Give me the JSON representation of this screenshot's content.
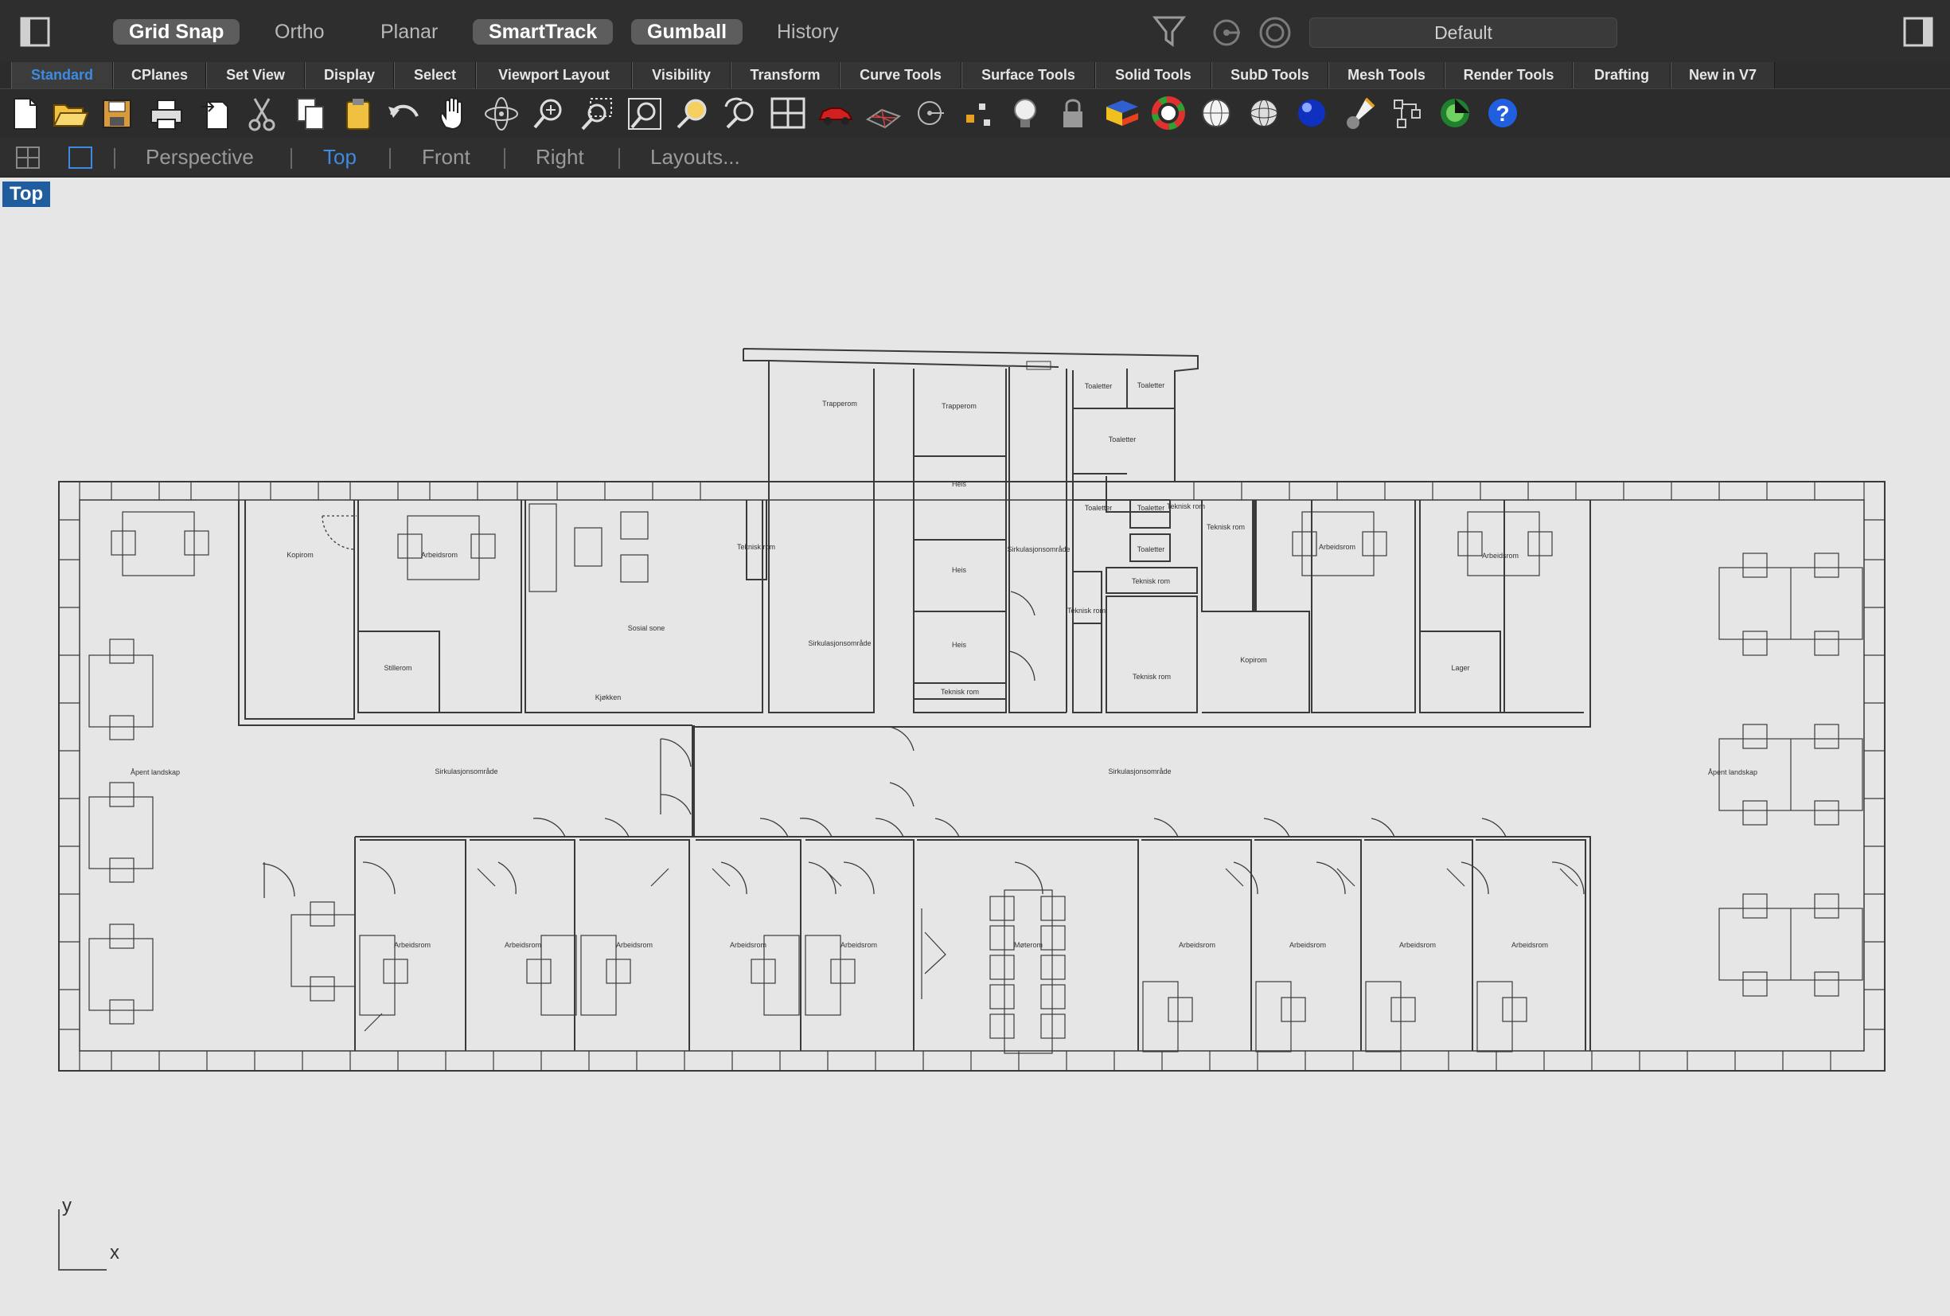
{
  "status_bar": {
    "toggles": [
      {
        "label": "Grid Snap",
        "on": true
      },
      {
        "label": "Ortho",
        "on": false
      },
      {
        "label": "Planar",
        "on": false
      },
      {
        "label": "SmartTrack",
        "on": true
      },
      {
        "label": "Gumball",
        "on": true
      },
      {
        "label": "History",
        "on": false
      }
    ],
    "layer": "Default"
  },
  "tabs": [
    "Standard",
    "CPlanes",
    "Set View",
    "Display",
    "Select",
    "Viewport Layout",
    "Visibility",
    "Transform",
    "Curve Tools",
    "Surface Tools",
    "Solid Tools",
    "SubD Tools",
    "Mesh Tools",
    "Render Tools",
    "Drafting",
    "New in V7"
  ],
  "active_tab": "Standard",
  "toolbar_icons": [
    "new-file-icon",
    "open-folder-icon",
    "save-icon",
    "print-icon",
    "import-icon",
    "cut-icon",
    "copy-icon",
    "paste-icon",
    "undo-icon",
    "pan-hand-icon",
    "rotate-view-icon",
    "zoom-icon",
    "zoom-window-icon",
    "zoom-extents-icon",
    "zoom-selected-icon",
    "undo-view-icon",
    "four-viewports-icon",
    "car-icon",
    "cplane-grid-icon",
    "circle-center-icon",
    "points-icon",
    "light-bulb-icon",
    "lock-icon",
    "layer-icon",
    "color-wheel-icon",
    "sphere-wire-icon",
    "sphere-shaded-icon",
    "sphere-render-icon",
    "spotlight-icon",
    "block-icon",
    "render-icon",
    "help-icon"
  ],
  "viewport_tabs": [
    "Perspective",
    "Top",
    "Front",
    "Right",
    "Layouts..."
  ],
  "active_viewport": "Top",
  "viewport_label": "Top",
  "axes": {
    "x": "x",
    "y": "y"
  },
  "room_labels": [
    "Trapperom",
    "Trapperom",
    "Toaletter",
    "Toaletter",
    "Toaletter",
    "Toaletter",
    "Toaletter",
    "Toaletter",
    "Teknisk rom",
    "Teknisk rom",
    "Teknisk rom",
    "Teknisk rom",
    "Teknisk rom",
    "Teknisk rom",
    "Teknisk rom",
    "Heis",
    "Heis",
    "Heis",
    "Sirkulasjonsområde",
    "Sirkulasjonsområde",
    "Sirkulasjonsområde",
    "Sirkulasjonsområde",
    "Kopirom",
    "Kopirom",
    "Arbeidsrom",
    "Arbeidsrom",
    "Arbeidsrom",
    "Stillerom",
    "Sosial sone",
    "Kjøkken",
    "Lager",
    "Åpent landskap",
    "Åpent landskap",
    "Arbeidsrom",
    "Arbeidsrom",
    "Arbeidsrom",
    "Arbeidsrom",
    "Arbeidsrom",
    "Møterom",
    "Arbeidsrom",
    "Arbeidsrom",
    "Arbeidsrom",
    "Arbeidsrom"
  ]
}
